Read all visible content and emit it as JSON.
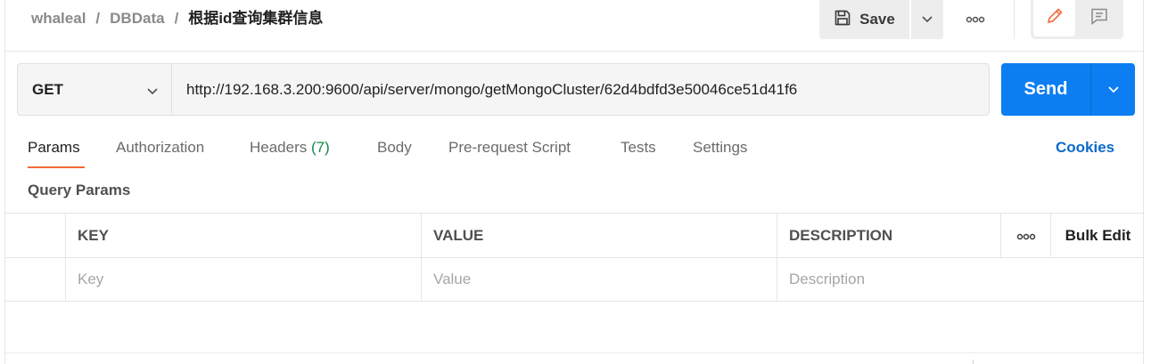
{
  "breadcrumb": {
    "items": [
      "whaleal",
      "DBData"
    ],
    "separator": "/",
    "current": "根据id查询集群信息"
  },
  "toolbar": {
    "save_label": "Save",
    "save_icon": "floppy-disk-icon",
    "more_icon": "more-horizontal-icon",
    "edit_icon": "pencil-icon",
    "comment_icon": "comment-icon"
  },
  "request": {
    "method": "GET",
    "url": "http://192.168.3.200:9600/api/server/mongo/getMongoCluster/62d4bdfd3e50046ce51d41f6",
    "send_label": "Send"
  },
  "tabs": [
    {
      "label": "Params",
      "active": true
    },
    {
      "label": "Authorization"
    },
    {
      "label": "Headers",
      "count": "(7)"
    },
    {
      "label": "Body"
    },
    {
      "label": "Pre-request Script"
    },
    {
      "label": "Tests"
    },
    {
      "label": "Settings"
    }
  ],
  "cookies_label": "Cookies",
  "query_params": {
    "title": "Query Params",
    "columns": [
      "KEY",
      "VALUE",
      "DESCRIPTION"
    ],
    "bulk_edit_label": "Bulk Edit",
    "placeholders": {
      "key": "Key",
      "value": "Value",
      "description": "Description"
    }
  },
  "colors": {
    "accent": "#f26b3a",
    "send": "#0d7ef2",
    "link": "#0b6bc9",
    "count": "#0f8a4a"
  }
}
